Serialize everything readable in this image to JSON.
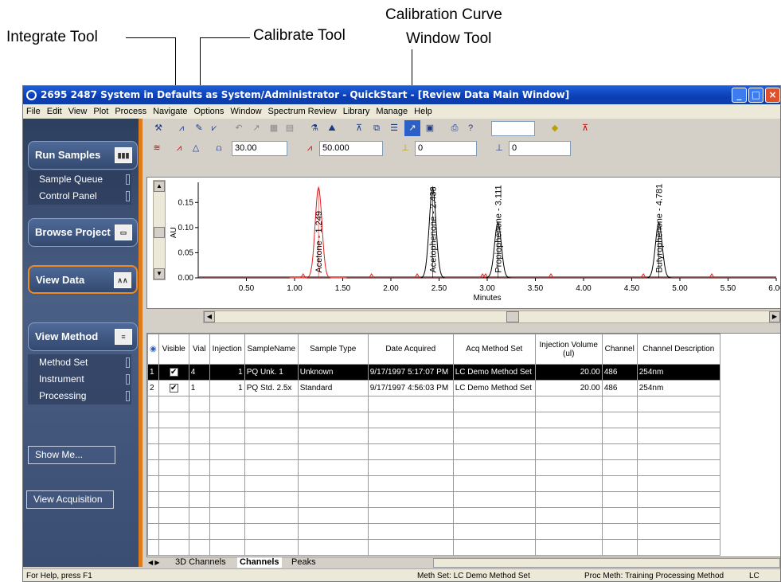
{
  "callouts": {
    "integrate": "Integrate Tool",
    "calibrate": "Calibrate Tool",
    "calibration_curve_line1": "Calibration Curve",
    "calibration_curve_line2": "Window Tool"
  },
  "window": {
    "title": "2695 2487 System in Defaults as System/Administrator - QuickStart - [Review Data Main Window]"
  },
  "menu": [
    "File",
    "Edit",
    "View",
    "Plot",
    "Process",
    "Navigate",
    "Options",
    "Window",
    "Spectrum Review",
    "Library",
    "Manage",
    "Help"
  ],
  "sidebar": {
    "run_samples": "Run Samples",
    "sample_queue": "Sample Queue",
    "control_panel": "Control Panel",
    "browse_project": "Browse Project",
    "view_data": "View Data",
    "view_method": "View Method",
    "method_set": "Method Set",
    "instrument": "Instrument",
    "processing": "Processing",
    "show_me": "Show Me...",
    "view_acquisition": "View Acquisition"
  },
  "toolbar": {
    "field1": "30.00",
    "field2": "50.000",
    "field3": "0",
    "field4": "0"
  },
  "chart_data": {
    "type": "line",
    "xlabel": "Minutes",
    "ylabel": "AU",
    "xlim": [
      0.0,
      6.0
    ],
    "ylim": [
      0.0,
      0.19
    ],
    "xticks": [
      "0.50",
      "1.00",
      "1.50",
      "2.00",
      "2.50",
      "3.00",
      "3.50",
      "4.00",
      "4.50",
      "5.00",
      "5.50",
      "6.00"
    ],
    "yticks": [
      "0.00",
      "0.05",
      "0.10",
      "0.15"
    ],
    "peaks": [
      {
        "label": "Acetone - 1.249",
        "rt": 1.249,
        "height": 0.18,
        "color": "#e02020"
      },
      {
        "label": "Acetophenone - 2.433",
        "rt": 2.433,
        "height": 0.18,
        "color": "#000000"
      },
      {
        "label": "Propiophenone - 3.111",
        "rt": 3.111,
        "height": 0.11,
        "color": "#000000"
      },
      {
        "label": "Butyrophenone - 4.781",
        "rt": 4.781,
        "height": 0.11,
        "color": "#000000"
      }
    ]
  },
  "table": {
    "headers": [
      "",
      "Visible",
      "Vial",
      "Injection",
      "SampleName",
      "Sample Type",
      "Date Acquired",
      "Acq Method Set",
      "Injection Volume (ul)",
      "Channel",
      "Channel Description"
    ],
    "rows": [
      [
        "1",
        "✔",
        "4",
        "1",
        "PQ Unk. 1",
        "Unknown",
        "9/17/1997 5:17:07 PM",
        "LC Demo Method Set",
        "20.00",
        "486",
        "254nm"
      ],
      [
        "2",
        "✔",
        "1",
        "1",
        "PQ Std. 2.5x",
        "Standard",
        "9/17/1997 4:56:03 PM",
        "LC Demo Method Set",
        "20.00",
        "486",
        "254nm"
      ]
    ]
  },
  "tabs": [
    "3D Channels",
    "Channels",
    "Peaks"
  ],
  "status": {
    "help": "For Help, press F1",
    "meth_set": "Meth Set: LC Demo Method Set",
    "proc_meth": "Proc Meth: Training Processing Method",
    "mode": "LC"
  }
}
